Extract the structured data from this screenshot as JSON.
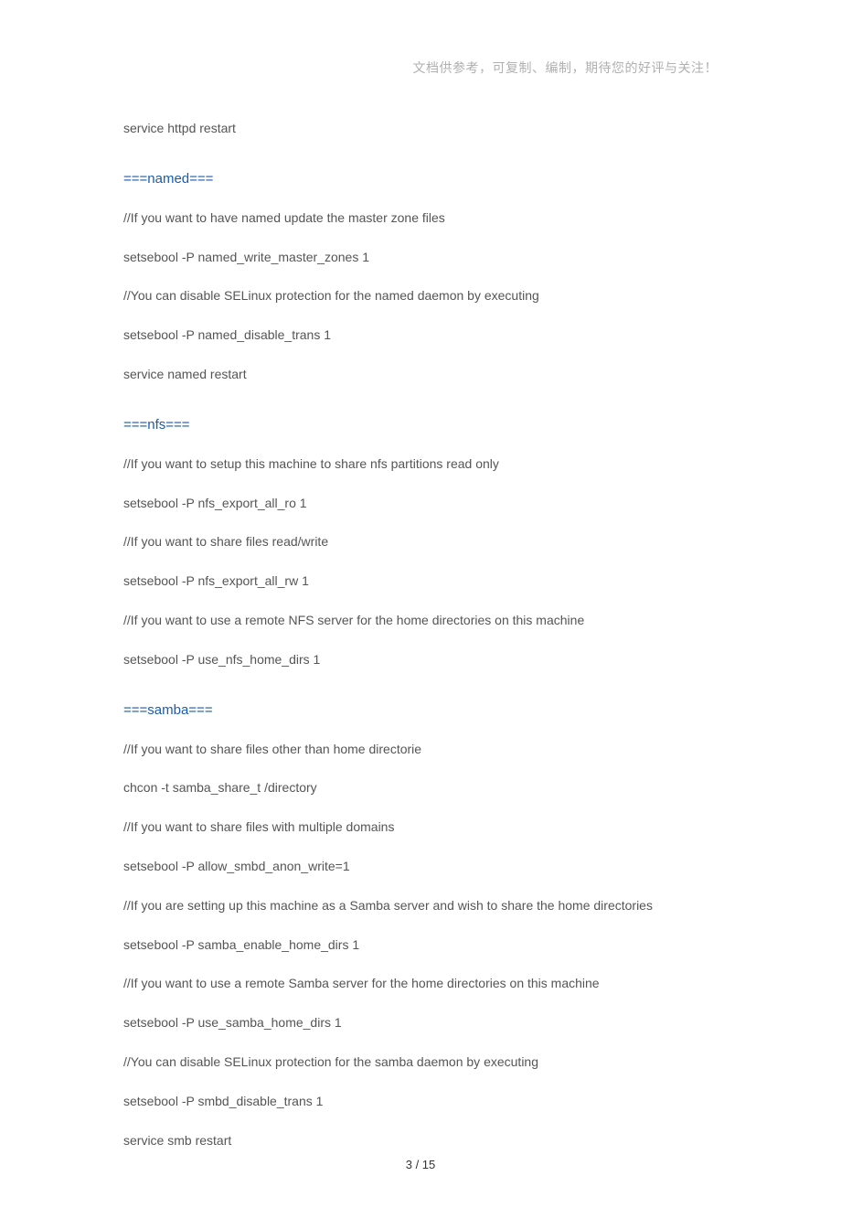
{
  "header_note": "文档供参考，可复制、编制，期待您的好评与关注！",
  "pre_lines": [
    "service httpd restart"
  ],
  "sections": [
    {
      "heading": "===named===",
      "lines": [
        "//If you want to have named update the master zone files",
        "setsebool -P named_write_master_zones 1",
        "//You can disable SELinux protection for the named daemon by executing",
        "setsebool -P named_disable_trans 1",
        "service named restart"
      ]
    },
    {
      "heading": "===nfs===",
      "lines": [
        "//If you want to setup this machine to share nfs partitions read only",
        "setsebool -P nfs_export_all_ro 1",
        "//If you want to share files read/write",
        "setsebool -P nfs_export_all_rw 1",
        "//If you want to use a remote NFS server for the home directories on this machine",
        "setsebool -P use_nfs_home_dirs 1"
      ]
    },
    {
      "heading": "===samba===",
      "lines": [
        "//If you want to share files other than home directorie",
        "chcon -t samba_share_t /directory",
        "//If you want to share files with multiple domains",
        "setsebool -P allow_smbd_anon_write=1",
        "//If you are setting up this machine as a Samba server and wish to share the home directories",
        "setsebool -P samba_enable_home_dirs 1",
        "//If you want to use a remote Samba server for the home directories on this machine",
        "setsebool -P use_samba_home_dirs 1",
        "//You can disable SELinux protection for the samba daemon by executing",
        "setsebool -P smbd_disable_trans 1",
        "service smb restart"
      ]
    }
  ],
  "page_number": "3 / 15"
}
